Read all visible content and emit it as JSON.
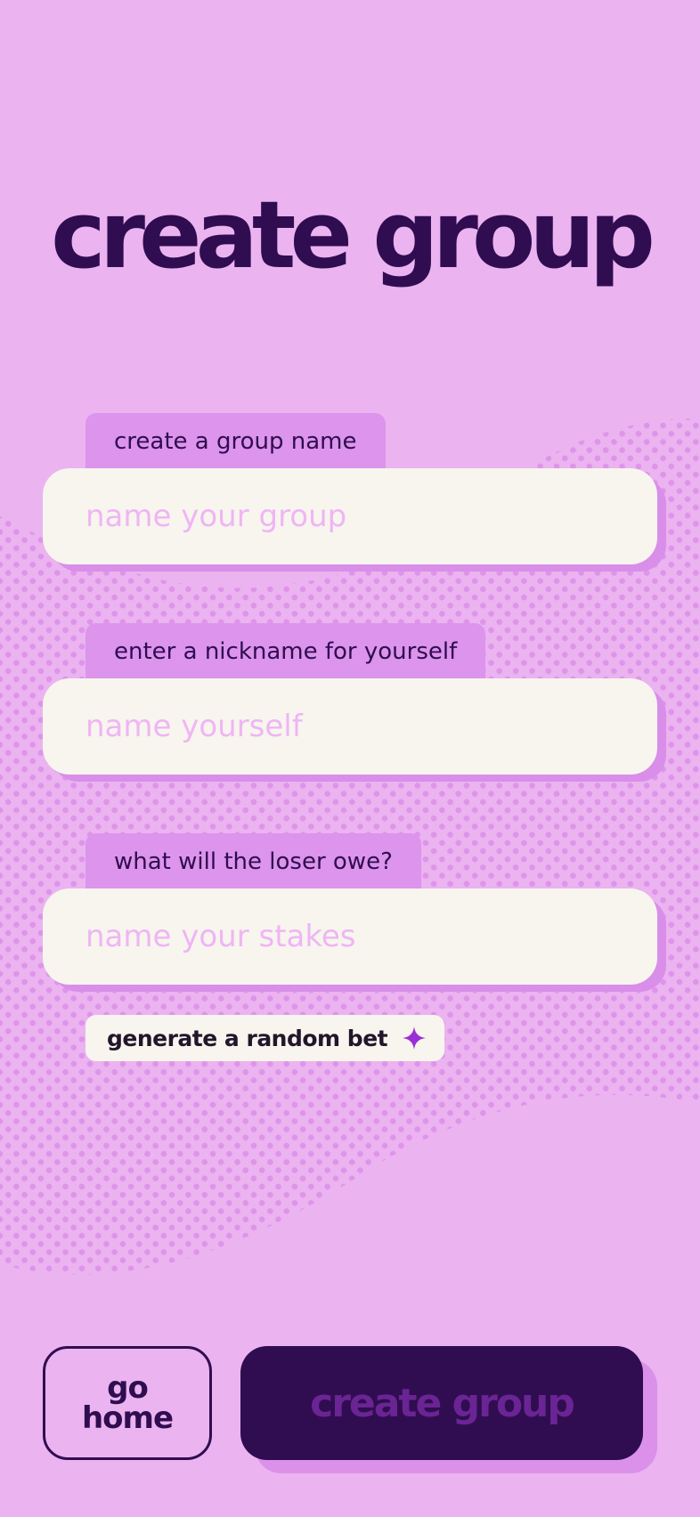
{
  "page": {
    "title": "create group"
  },
  "form": {
    "fields": [
      {
        "label": "create a group name",
        "placeholder": "name your group",
        "value": ""
      },
      {
        "label": "enter a nickname for yourself",
        "placeholder": "name yourself",
        "value": ""
      },
      {
        "label": "what will the loser owe?",
        "placeholder": "name your stakes",
        "value": ""
      }
    ],
    "random_bet_label": "generate a random bet",
    "random_bet_icon": "sparkle-icon"
  },
  "actions": {
    "go_home_line1": "go",
    "go_home_line2": "home",
    "create_label": "create group"
  },
  "colors": {
    "background": "#ebb3f0",
    "dark_purple": "#300d50",
    "label_tab": "#dc94ec",
    "input_bg": "#f7f5ee",
    "placeholder": "#efb5f4",
    "sparkle": "#9b2fd6"
  }
}
